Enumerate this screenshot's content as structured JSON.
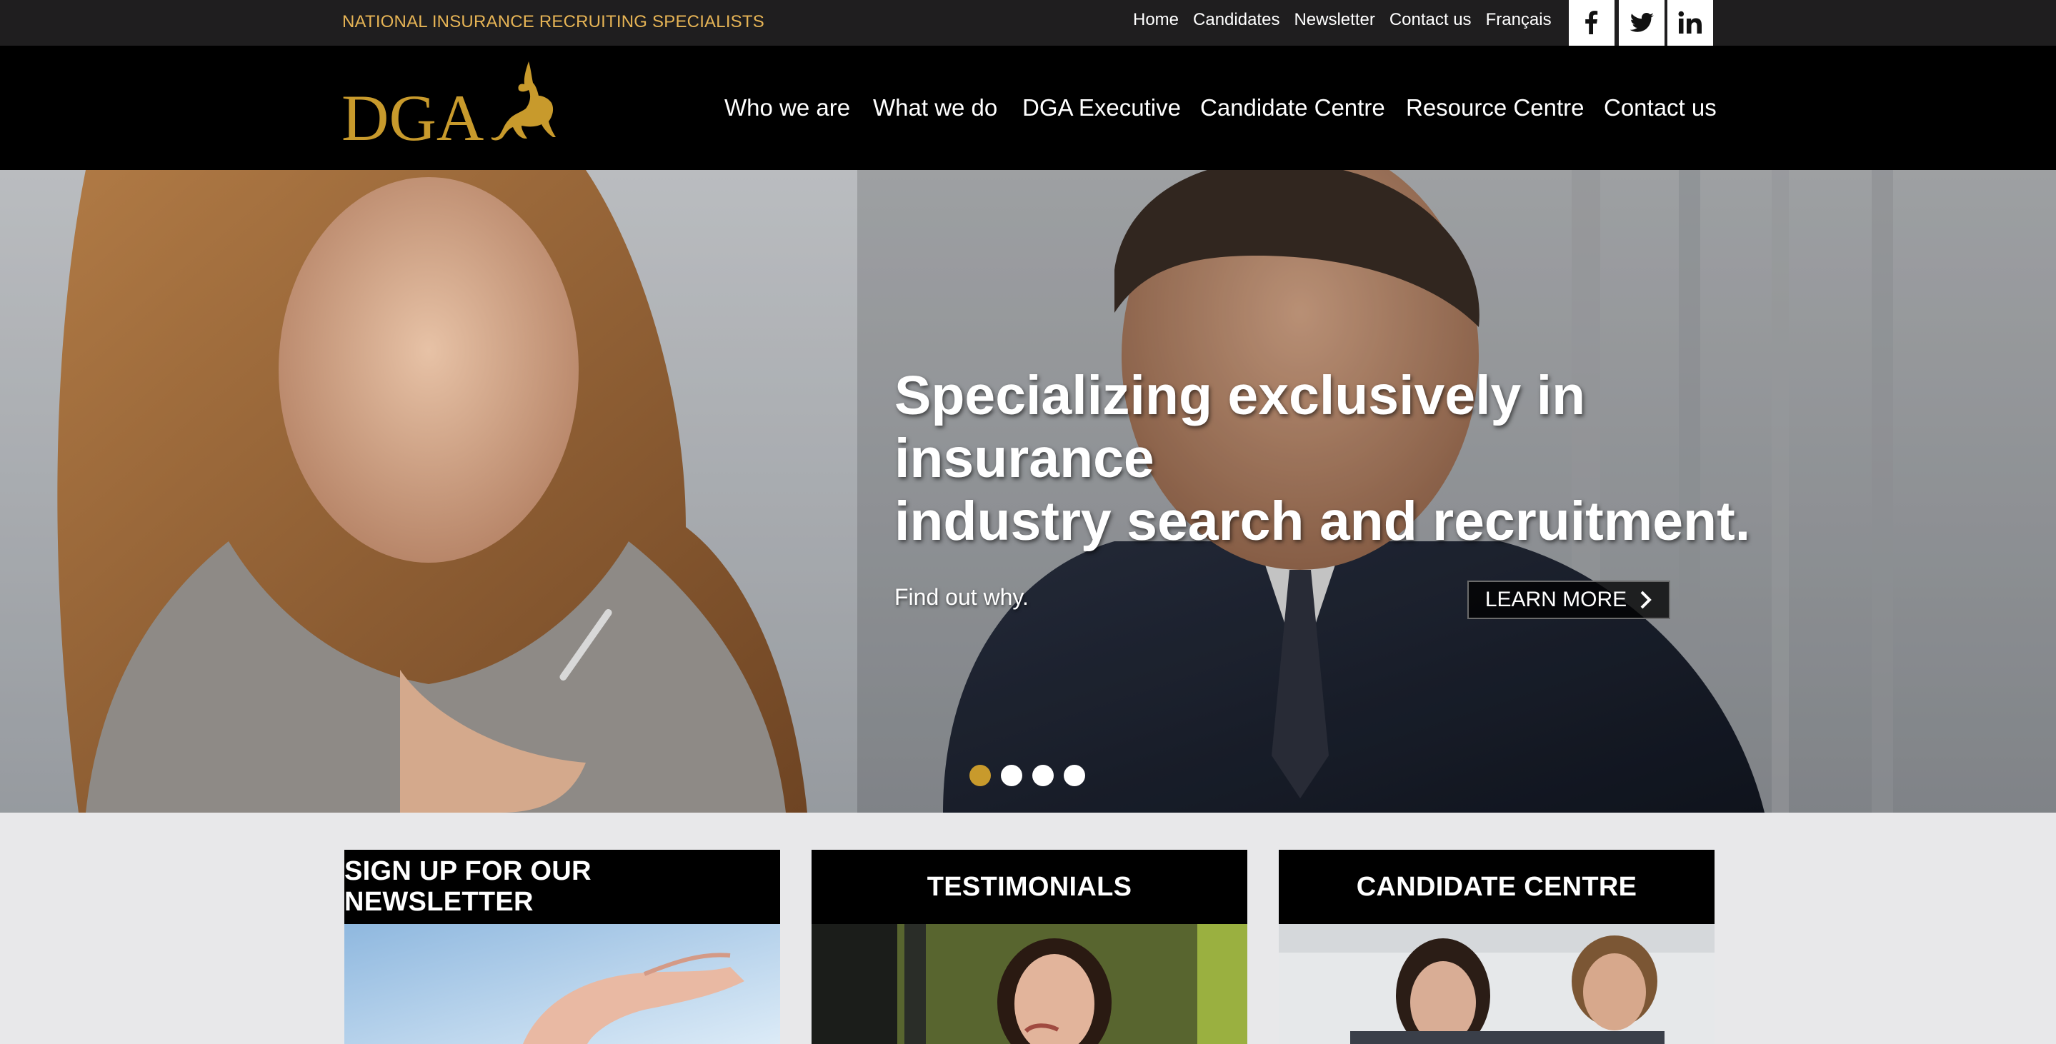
{
  "topbar": {
    "tagline": "NATIONAL INSURANCE RECRUITING SPECIALISTS",
    "links": [
      "Home",
      "Candidates",
      "Newsletter",
      "Contact us",
      "Français"
    ],
    "social": [
      {
        "name": "facebook-icon",
        "glyph": "f"
      },
      {
        "name": "twitter-icon",
        "glyph": "bird"
      },
      {
        "name": "linkedin-icon",
        "glyph": "in"
      }
    ]
  },
  "brand": {
    "logo_text": "DGA",
    "logo_color": "#c89a2c"
  },
  "nav": {
    "items": [
      "Who we are",
      "What we do",
      "DGA Executive",
      "Candidate Centre",
      "Resource Centre",
      "Contact us"
    ]
  },
  "hero": {
    "headline_line1": "Specializing exclusively in insurance",
    "headline_line2": "industry search and recruitment.",
    "subline": "Find out why.",
    "button_label": "LEARN MORE",
    "slides": 4,
    "active_slide": 1
  },
  "cards": [
    {
      "title": "SIGN UP FOR OUR NEWSLETTER"
    },
    {
      "title": "TESTIMONIALS"
    },
    {
      "title": "CANDIDATE CENTRE"
    }
  ],
  "colors": {
    "accent": "#c89a2c",
    "tagline": "#e6b455",
    "topbar_bg": "#1f1e1f",
    "nav_bg": "#000000",
    "page_bg": "#e8e8ea"
  }
}
